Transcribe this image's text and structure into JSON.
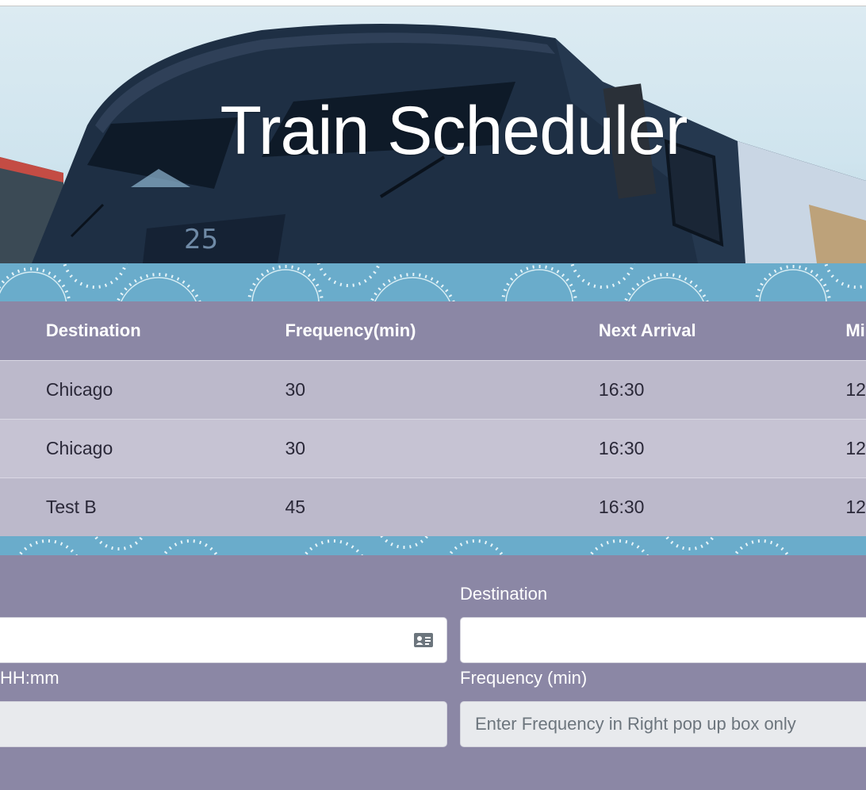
{
  "page": {
    "title": "Train Scheduler"
  },
  "colors": {
    "header_bg": "#8b87a5",
    "row_odd": "#bcb9cb",
    "row_even": "#c6c3d3",
    "track_band": "#6aaccb"
  },
  "table": {
    "headers": [
      "Destination",
      "Frequency(min)",
      "Next Arrival",
      "Mi"
    ],
    "rows": [
      {
        "destination": "Chicago",
        "frequency": "30",
        "next_arrival": "16:30",
        "minutes_away": "12"
      },
      {
        "destination": "Chicago",
        "frequency": "30",
        "next_arrival": "16:30",
        "minutes_away": "12"
      },
      {
        "destination": "Test B",
        "frequency": "45",
        "next_arrival": "16:30",
        "minutes_away": "12"
      }
    ]
  },
  "form": {
    "train_name_icon": "contact-card-icon",
    "destination_label": "Destination",
    "destination_value": "",
    "first_time_label": "HH:mm",
    "frequency_label": "Frequency (min)",
    "frequency_placeholder": "Enter Frequency in Right pop up box only"
  }
}
